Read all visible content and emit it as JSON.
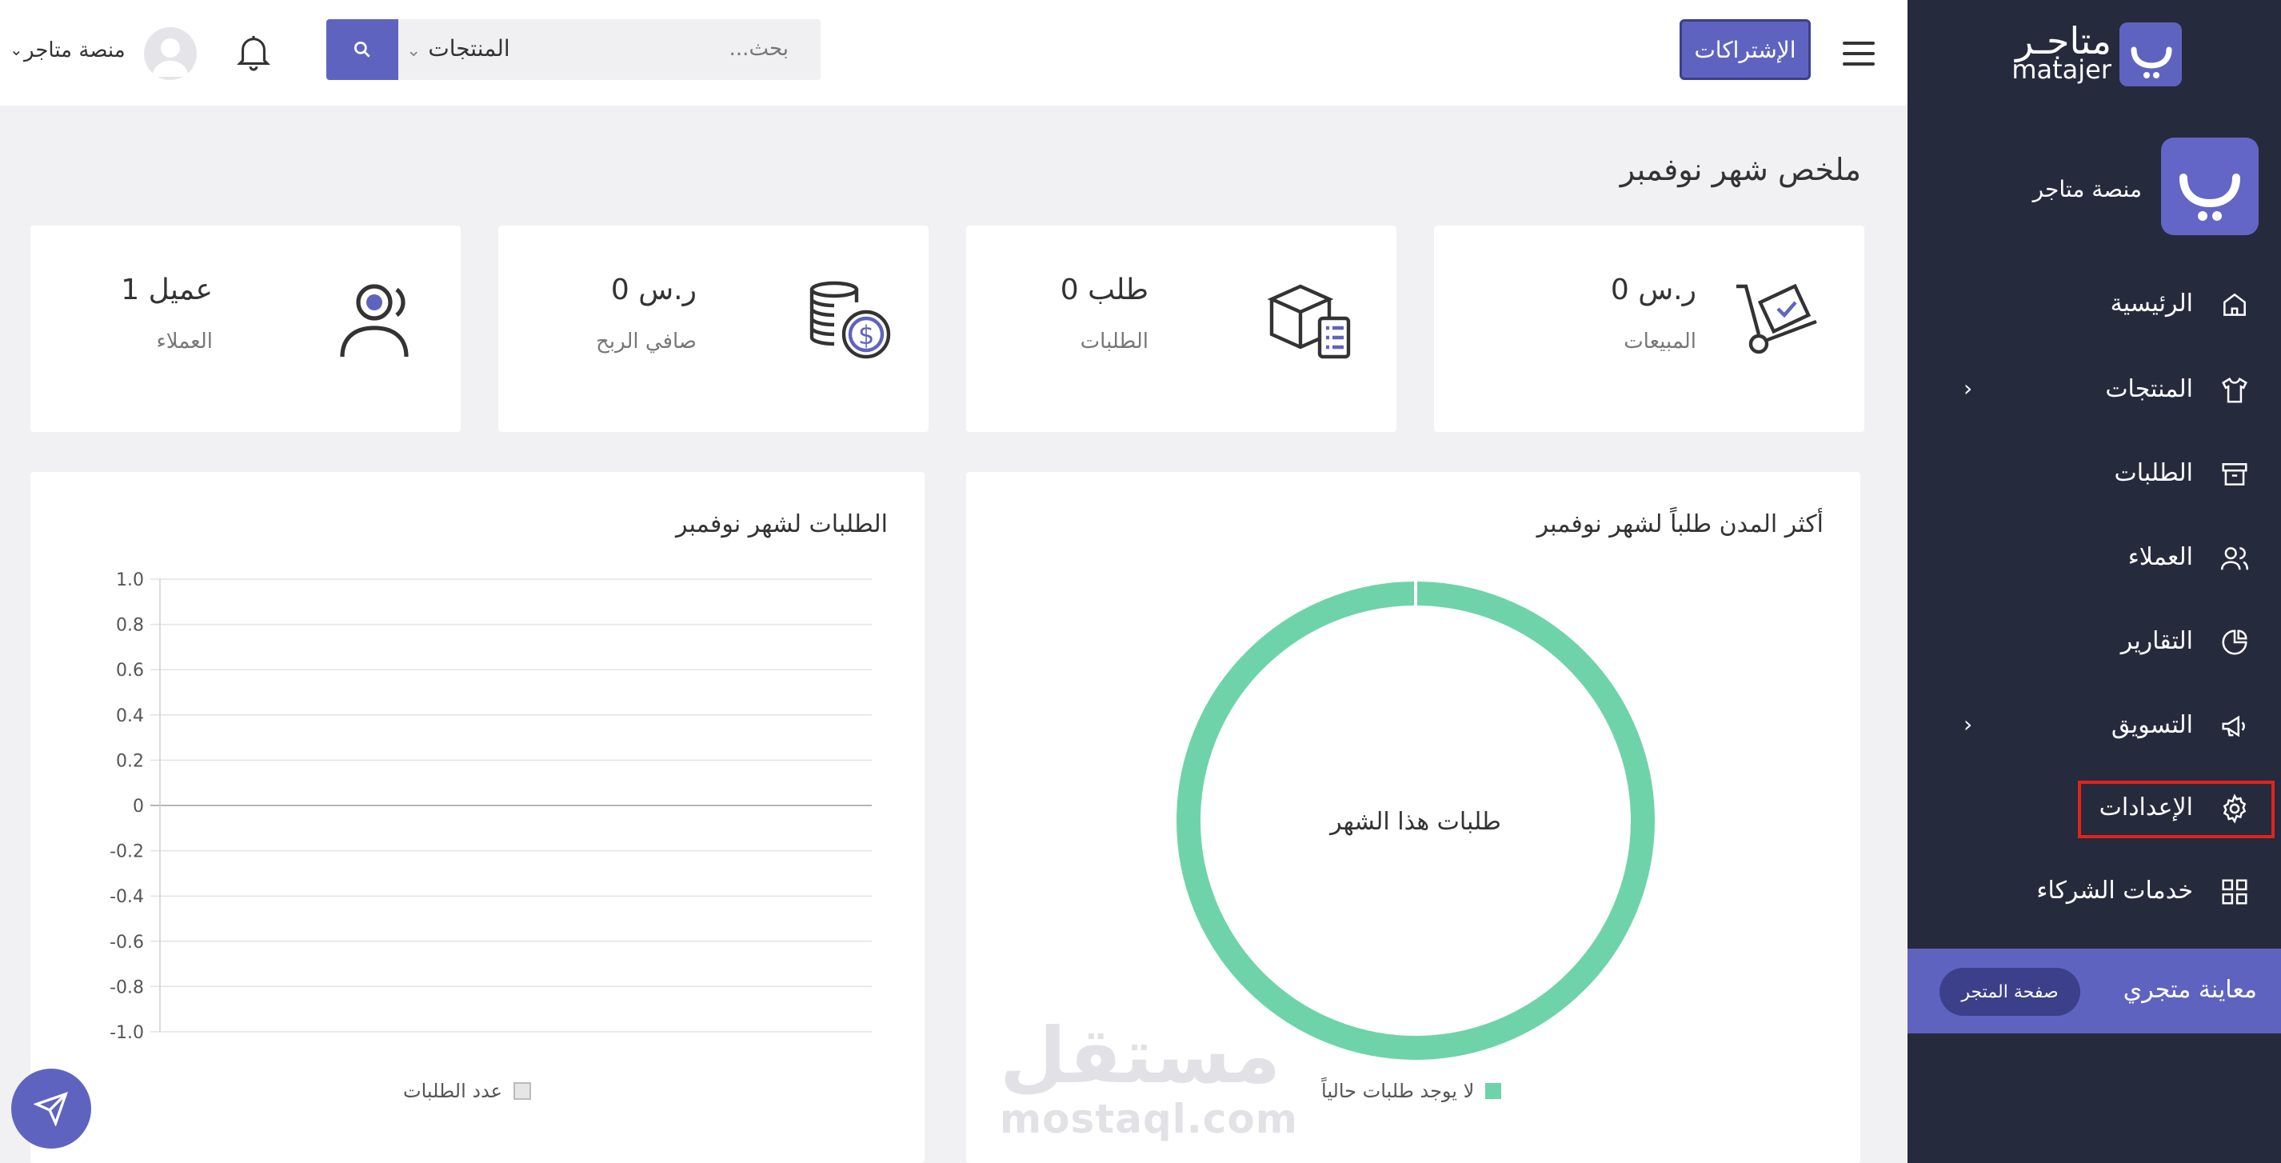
{
  "sidebar": {
    "logo_ar": "متاجـر",
    "logo_en": "matajer",
    "store_name": "منصة متاجر",
    "items": [
      {
        "label": "الرئيسية",
        "icon": "home-icon"
      },
      {
        "label": "المنتجات",
        "icon": "shirt-icon",
        "has_children": true
      },
      {
        "label": "الطلبات",
        "icon": "archive-icon"
      },
      {
        "label": "العملاء",
        "icon": "users-icon"
      },
      {
        "label": "التقارير",
        "icon": "pie-chart-icon"
      },
      {
        "label": "التسويق",
        "icon": "megaphone-icon",
        "has_children": true
      },
      {
        "label": "الإعدادات",
        "icon": "gear-icon",
        "highlighted": true
      },
      {
        "label": "خدمات الشركاء",
        "icon": "grid-icon"
      }
    ],
    "preview_label": "معاينة متجري",
    "preview_button": "صفحة المتجر"
  },
  "topbar": {
    "subscriptions_button": "الإشتراكات",
    "search_category": "المنتجات",
    "search_placeholder": "بحث...",
    "user_name": "منصة متاجر"
  },
  "main": {
    "page_title": "ملخص شهر نوفمبر",
    "cards": [
      {
        "value": "0 ر.س",
        "label": "المبيعات",
        "icon": "trolley-icon"
      },
      {
        "value": "0 طلب",
        "label": "الطلبات",
        "icon": "package-checklist-icon"
      },
      {
        "value": "0 ر.س",
        "label": "صافي الربح",
        "icon": "coins-icon"
      },
      {
        "value": "1 عميل",
        "label": "العملاء",
        "icon": "customers-icon"
      }
    ],
    "donut_panel": {
      "title": "أكثر المدن طلباً لشهر نوفمبر",
      "center_text": "طلبات هذا الشهر",
      "legend": "لا يوجد طلبات حالياً"
    },
    "line_panel": {
      "title": "الطلبات لشهر نوفمبر",
      "legend": "عدد الطلبات",
      "y_ticks": [
        "1.0",
        "0.8",
        "0.6",
        "0.4",
        "0.2",
        "0",
        "-0.2",
        "-0.4",
        "-0.6",
        "-0.8",
        "-1.0"
      ]
    }
  },
  "colors": {
    "sidebar_bg": "#262a3d",
    "accent": "#5f63c0",
    "donut": "#6fd3aa",
    "highlight_border": "#e2231a"
  },
  "watermark": {
    "ar": "مستقل",
    "en": "mostaql.com"
  }
}
